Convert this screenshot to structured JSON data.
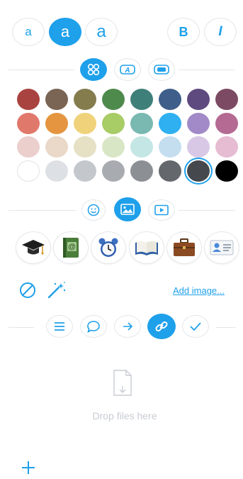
{
  "font_size_buttons": [
    {
      "label": "a",
      "size": "small"
    },
    {
      "label": "a",
      "size": "medium"
    },
    {
      "label": "a",
      "size": "large"
    }
  ],
  "style_buttons": {
    "bold_label": "B",
    "italic_label": "I"
  },
  "color_tabs": [
    "palette-icon",
    "text-color-icon",
    "background-color-icon"
  ],
  "colors": [
    [
      "#a8433f",
      "#7a6453",
      "#847c4d",
      "#4f8a4d",
      "#3f7f7a",
      "#3f5e8a",
      "#5e4a7f",
      "#7c4a62"
    ],
    [
      "#e1786c",
      "#e5953f",
      "#f0d27a",
      "#a8cc66",
      "#7ab8b2",
      "#2fb0f0",
      "#a28ac8",
      "#b46a92"
    ],
    [
      "#ebcfcd",
      "#ead8c8",
      "#e6e0c4",
      "#d9e6c6",
      "#c4e6e4",
      "#c4def0",
      "#d8c8e6",
      "#e6bcd2"
    ],
    [
      "#ffffff",
      "#dde1e5",
      "#c4c8cc",
      "#a8acb0",
      "#8c9094",
      "#64686c",
      "#45484c",
      "#000000"
    ]
  ],
  "selected_color": "#45484c",
  "media_tabs": [
    "smiley-icon",
    "image-icon",
    "video-icon"
  ],
  "item_images": [
    "graduation-cap-icon",
    "address-book-icon",
    "alarm-clock-icon",
    "open-book-icon",
    "briefcase-icon",
    "id-card-icon"
  ],
  "add_image_label": "Add image...",
  "action_tabs": [
    "list-icon",
    "comment-icon",
    "arrow-right-icon",
    "link-icon",
    "check-icon"
  ],
  "drop_label": "Drop files here",
  "accent": "#1ea0ea"
}
